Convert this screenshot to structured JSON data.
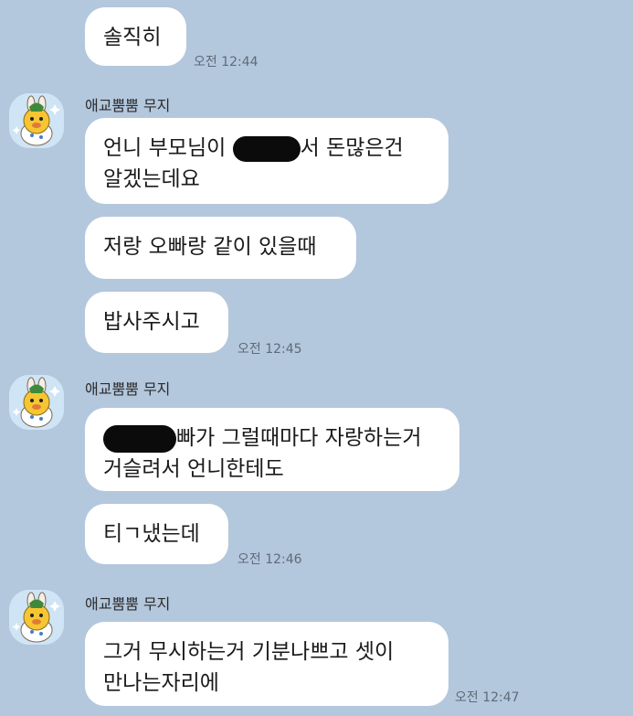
{
  "messages": [
    {
      "text": "솔직히",
      "time": "오전 12:44"
    },
    {
      "sender": "애교뿜뿜 무지",
      "avatar_icon": "muzi-avatar-icon",
      "lines": [
        "언니 부모님이 ",
        "서 돈많은건",
        "알겠는데요"
      ]
    },
    {
      "text": "저랑 오빠랑 같이 있을때"
    },
    {
      "text": "밥사주시고",
      "time": "오전 12:45"
    },
    {
      "sender": "애교뿜뿜 무지",
      "avatar_icon": "muzi-avatar-icon",
      "lines": [
        "빠가 그럴때마다 자랑하는거",
        "거슬려서 언니한테도"
      ]
    },
    {
      "text": "티ㄱ냈는데",
      "time": "오전 12:46"
    },
    {
      "sender": "애교뿜뿜 무지",
      "avatar_icon": "muzi-avatar-icon",
      "lines": [
        "그거 무시하는거 기분나쁘고 셋이",
        "만나는자리에"
      ],
      "time": "오전 12:47"
    }
  ],
  "colors": {
    "background": "#b3c7dd",
    "bubble": "#ffffff",
    "text": "#1a1a1a",
    "time": "#5f6b78",
    "redaction": "#0b0b0b"
  }
}
